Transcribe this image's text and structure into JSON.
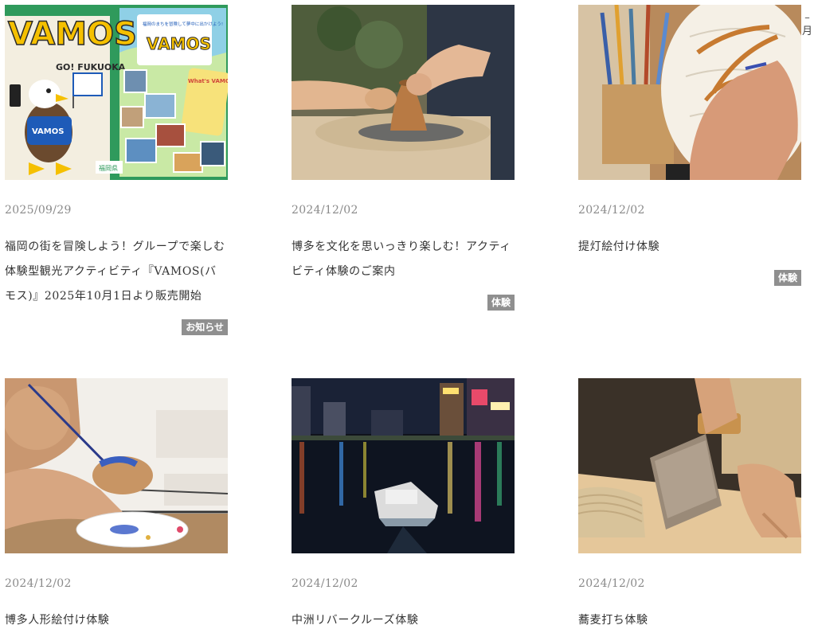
{
  "edge_text": [
    "–",
    "月"
  ],
  "cards": [
    {
      "date": "2025/09/29",
      "title": "福岡の街を冒険しよう！グループで楽しむ体験型観光アクティビティ『VAMOS(バモス)』2025年10月1日より販売開始",
      "tag": "お知らせ",
      "image": {
        "logo": "VAMOS",
        "logo2": "VAMOS",
        "sub": "GO! FUKUOKA",
        "caption": "福岡のまちを冒険して夢中に出かけよう!",
        "side": "What's VAMOS",
        "badge": "福岡県",
        "mascot_label": "VAMOS"
      }
    },
    {
      "date": "2024/12/02",
      "title": "博多を文化を思いっきり楽しむ！アクティビティ体験のご案内",
      "tag": "体験"
    },
    {
      "date": "2024/12/02",
      "title": "提灯絵付け体験",
      "tag": "体験"
    },
    {
      "date": "2024/12/02",
      "title": "博多人形絵付け体験",
      "tag": ""
    },
    {
      "date": "2024/12/02",
      "title": "中洲リバークルーズ体験",
      "tag": ""
    },
    {
      "date": "2024/12/02",
      "title": "蕎麦打ち体験",
      "tag": ""
    }
  ]
}
